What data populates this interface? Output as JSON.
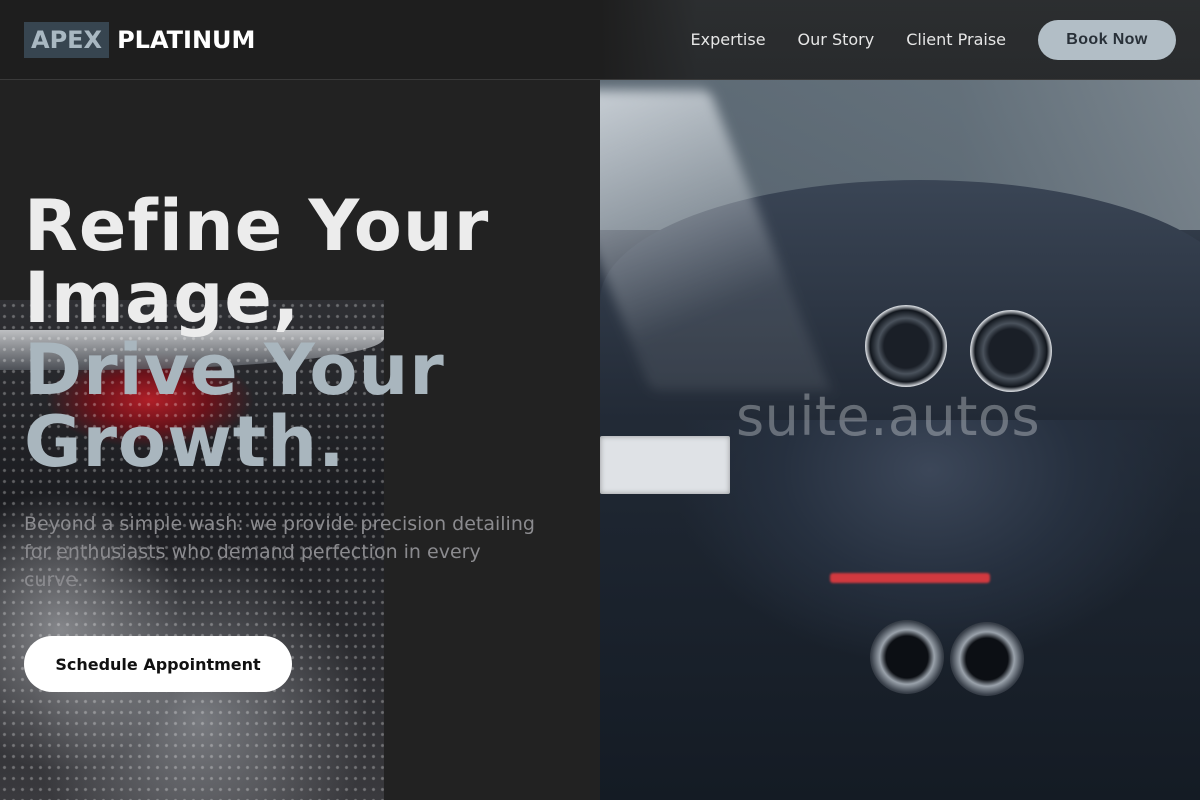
{
  "header": {
    "logo": {
      "mark": "APEX",
      "word": "PLATINUM"
    },
    "nav": [
      {
        "label": "Expertise"
      },
      {
        "label": "Our Story"
      },
      {
        "label": "Client Praise"
      }
    ],
    "cta_label": "Book Now"
  },
  "hero": {
    "headline_line1": "Refine Your Image,",
    "headline_line2": "Drive Your Growth.",
    "subtitle": "Beyond a simple wash: we provide precision detailing for enthusiasts who demand perfection in every curve.",
    "cta_label": "Schedule Appointment"
  },
  "imagery": {
    "watermark": "suite.autos"
  },
  "colors": {
    "background": "#222222",
    "accent": "#b2bec6",
    "logo_mark_bg": "#374550",
    "headline_secondary": "#a9b6be"
  }
}
